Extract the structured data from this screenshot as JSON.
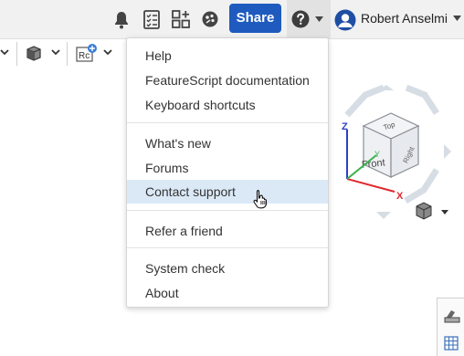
{
  "header": {
    "share_label": "Share",
    "user_name": "Robert Anselmi"
  },
  "icons": {
    "notifications": "bell-icon",
    "tasks": "tasks-icon",
    "apps": "app-store-icon",
    "learning": "learning-center-icon",
    "help": "help-circle-icon",
    "avatar": "user-avatar-icon"
  },
  "toolbar": {
    "view_icon": "view-cube-icon",
    "render_icon": "render-mode-icon",
    "reference_icon": "reference-icon"
  },
  "help_menu": {
    "items": [
      {
        "label": "Help"
      },
      {
        "label": "FeatureScript documentation"
      },
      {
        "label": "Keyboard shortcuts"
      },
      {
        "label": "What's new"
      },
      {
        "label": "Forums"
      },
      {
        "label": "Contact support"
      },
      {
        "label": "Refer a friend"
      },
      {
        "label": "System check"
      },
      {
        "label": "About"
      }
    ],
    "highlighted": "Contact support"
  },
  "view_cube": {
    "faces": {
      "top": "Top",
      "front": "Front",
      "right": "Right"
    },
    "axes": {
      "x": "X",
      "y": "Y",
      "z": "Z"
    },
    "colors": {
      "x": "#e0282e",
      "y": "#3bb34a",
      "z": "#2c3fc7"
    }
  },
  "colors": {
    "share_bg": "#1f5bbf",
    "menu_highlight": "#dbe9f7",
    "topbar_bg": "#f1f1f1"
  }
}
